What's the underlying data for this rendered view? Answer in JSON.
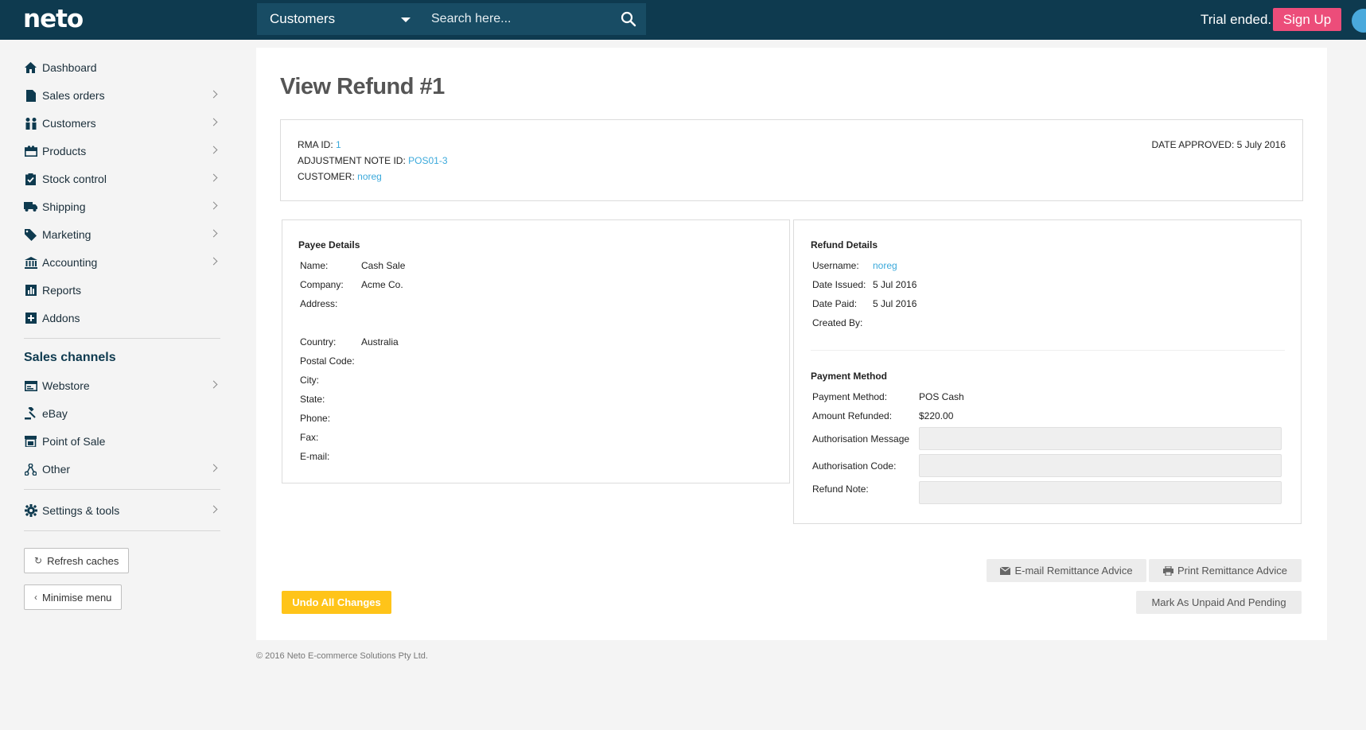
{
  "header": {
    "logo": "neto",
    "scope_select": "Customers",
    "search_placeholder": "Search here...",
    "trial_text": "Trial ended.",
    "signup_label": "Sign Up"
  },
  "sidebar": {
    "items": [
      {
        "label": "Dashboard",
        "icon": "home-icon"
      },
      {
        "label": "Sales orders",
        "icon": "document-icon"
      },
      {
        "label": "Customers",
        "icon": "users-icon"
      },
      {
        "label": "Products",
        "icon": "gift-icon"
      },
      {
        "label": "Stock control",
        "icon": "clipboard-check-icon"
      },
      {
        "label": "Shipping",
        "icon": "truck-icon"
      },
      {
        "label": "Marketing",
        "icon": "tag-icon"
      },
      {
        "label": "Accounting",
        "icon": "bank-icon"
      },
      {
        "label": "Reports",
        "icon": "bar-chart-icon"
      },
      {
        "label": "Addons",
        "icon": "plus-square-icon"
      }
    ],
    "channels_title": "Sales channels",
    "channels": [
      {
        "label": "Webstore",
        "icon": "browser-icon"
      },
      {
        "label": "eBay",
        "icon": "gavel-icon"
      },
      {
        "label": "Point of Sale",
        "icon": "pos-icon"
      },
      {
        "label": "Other",
        "icon": "network-icon"
      }
    ],
    "settings": "Settings & tools",
    "refresh_label": "Refresh caches",
    "minimise_label": "Minimise menu"
  },
  "page": {
    "title": "View Refund #1",
    "summary": {
      "rma_label": "RMA ID:",
      "rma_value": "1",
      "adj_label": "ADJUSTMENT NOTE ID:",
      "adj_value": "POS01-3",
      "customer_label": "CUSTOMER:",
      "customer_value": "noreg",
      "date_approved": "DATE APPROVED: 5 July 2016"
    },
    "payee": {
      "title": "Payee Details",
      "name_label": "Name:",
      "name_value": "Cash Sale",
      "company_label": "Company:",
      "company_value": "Acme Co.",
      "address_label": "Address:",
      "country_label": "Country:",
      "country_value": "Australia",
      "postal_label": "Postal Code:",
      "city_label": "City:",
      "state_label": "State:",
      "phone_label": "Phone:",
      "fax_label": "Fax:",
      "email_label": "E-mail:"
    },
    "refund": {
      "title": "Refund Details",
      "username_label": "Username:",
      "username_value": "noreg",
      "issued_label": "Date Issued:",
      "issued_value": "5 Jul 2016",
      "paid_label": "Date Paid:",
      "paid_value": "5 Jul 2016",
      "created_label": "Created By:"
    },
    "payment": {
      "title": "Payment Method",
      "method_label": "Payment Method:",
      "method_value": "POS Cash",
      "amount_label": "Amount Refunded:",
      "amount_value": "$220.00",
      "auth_msg_label": "Authorisation Message",
      "auth_code_label": "Authorisation Code:",
      "note_label": "Refund Note:"
    },
    "actions": {
      "email_label": "E-mail Remittance Advice",
      "print_label": "Print Remittance Advice",
      "undo_label": "Undo All Changes",
      "mark_label": "Mark As Unpaid And Pending"
    }
  },
  "footer": "© 2016 Neto E-commerce Solutions Pty Ltd."
}
